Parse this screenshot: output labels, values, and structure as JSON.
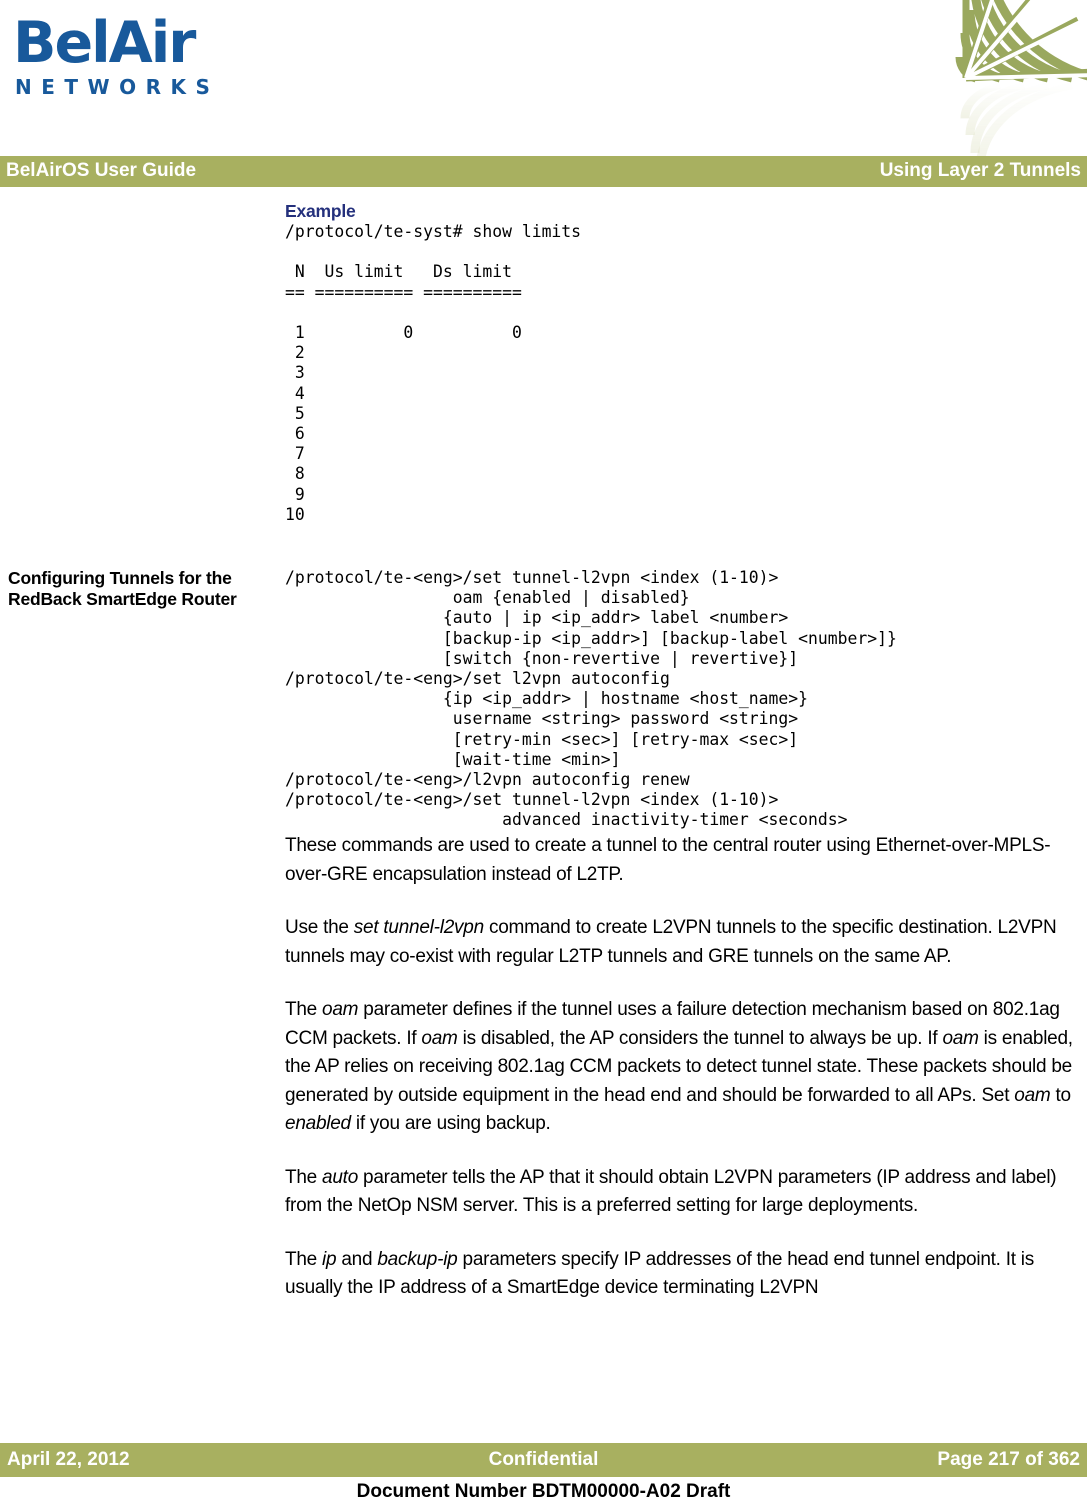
{
  "brand": {
    "wordmark": "BelAir",
    "subword": "NETWORKS",
    "logo_color": "#18599b",
    "deco_color": "#a8b060",
    "deco_icon": "radial-web-fan-graphic"
  },
  "header": {
    "left": "BelAirOS User Guide",
    "right": "Using Layer 2 Tunnels",
    "band_color": "#a8b060",
    "text_color": "#ffffff"
  },
  "content": {
    "example_heading": "Example",
    "example_heading_color": "#24307c",
    "example_code": "/protocol/te-syst# show limits\n\n N  Us limit   Ds limit\n== ========== ==========\n\n 1          0          0\n 2\n 3\n 4\n 5\n 6\n 7\n 8\n 9\n10",
    "section_margin_heading": "Configuring Tunnels for the RedBack SmartEdge Router",
    "syntax_code": "/protocol/te-<eng>/set tunnel-l2vpn <index (1-10)>\n                 oam {enabled | disabled}\n                {auto | ip <ip_addr> label <number>\n                [backup-ip <ip_addr>] [backup-label <number>]}\n                [switch {non-revertive | revertive}]\n/protocol/te-<eng>/set l2vpn autoconfig\n                {ip <ip_addr> | hostname <host_name>}\n                 username <string> password <string>\n                 [retry-min <sec>] [retry-max <sec>]\n                 [wait-time <min>]\n/protocol/te-<eng>/l2vpn autoconfig renew\n/protocol/te-<eng>/set tunnel-l2vpn <index (1-10)>\n                      advanced inactivity-timer <seconds>",
    "paragraphs": [
      {
        "id": "p1",
        "runs": [
          {
            "t": "These commands are used to create a tunnel to the central router using Ethernet-over-MPLS-over-GRE encapsulation instead of L2TP.",
            "i": false
          }
        ]
      },
      {
        "id": "p2",
        "runs": [
          {
            "t": "Use the ",
            "i": false
          },
          {
            "t": "set tunnel-l2vpn",
            "i": true
          },
          {
            "t": " command to create L2VPN tunnels to the specific destination. L2VPN tunnels may co-exist with regular L2TP tunnels and GRE tunnels on the same AP.",
            "i": false
          }
        ]
      },
      {
        "id": "p3",
        "runs": [
          {
            "t": "The ",
            "i": false
          },
          {
            "t": "oam",
            "i": true
          },
          {
            "t": " parameter defines if the tunnel uses a failure detection mechanism based on 802.1ag CCM packets. If ",
            "i": false
          },
          {
            "t": "oam",
            "i": true
          },
          {
            "t": " is disabled, the AP considers the tunnel to always be up. If ",
            "i": false
          },
          {
            "t": "oam",
            "i": true
          },
          {
            "t": " is enabled, the AP relies on receiving 802.1ag CCM packets to detect tunnel state. These packets should be generated by outside equipment in the head end and should be forwarded to all APs. Set ",
            "i": false
          },
          {
            "t": "oam",
            "i": true
          },
          {
            "t": " to ",
            "i": false
          },
          {
            "t": "enabled",
            "i": true
          },
          {
            "t": " if you are using backup.",
            "i": false
          }
        ]
      },
      {
        "id": "p4",
        "runs": [
          {
            "t": "The ",
            "i": false
          },
          {
            "t": "auto",
            "i": true
          },
          {
            "t": " parameter tells the AP that it should obtain L2VPN parameters (IP address and label) from the NetOp NSM server. This is a preferred setting for large deployments.",
            "i": false
          }
        ]
      },
      {
        "id": "p5",
        "runs": [
          {
            "t": "The ",
            "i": false
          },
          {
            "t": "ip",
            "i": true
          },
          {
            "t": " and ",
            "i": false
          },
          {
            "t": "backup-ip",
            "i": true
          },
          {
            "t": " parameters specify IP addresses of the head end tunnel endpoint. It is usually the IP address of a SmartEdge device terminating L2VPN",
            "i": false
          }
        ]
      }
    ]
  },
  "footer": {
    "date": "April 22, 2012",
    "center": "Confidential",
    "page": "Page 217 of 362",
    "document_number": "Document Number BDTM00000-A02 Draft",
    "band_color": "#a8b060"
  }
}
